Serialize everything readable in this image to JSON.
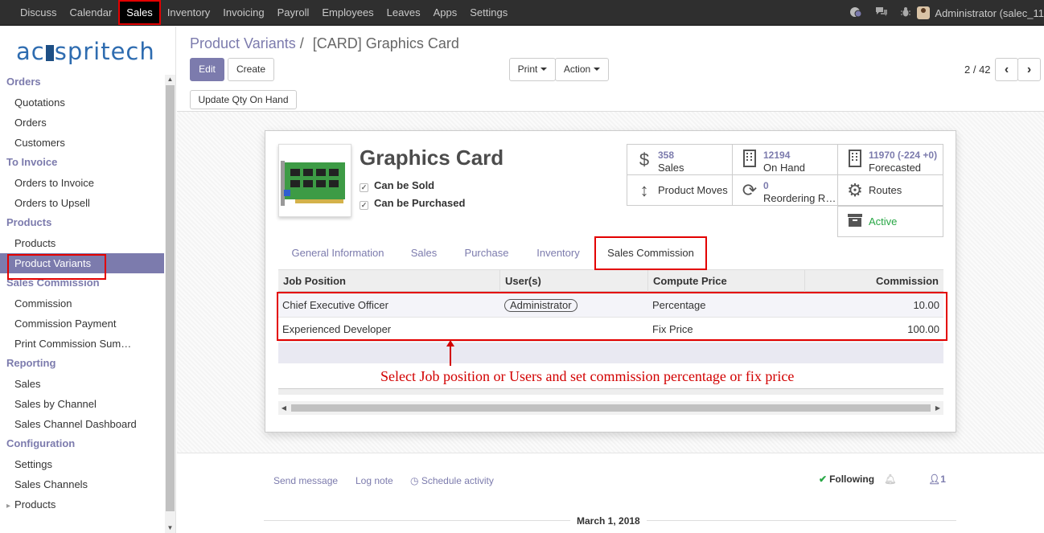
{
  "topbar": {
    "menu": [
      "Discuss",
      "Calendar",
      "Sales",
      "Inventory",
      "Invoicing",
      "Payroll",
      "Employees",
      "Leaves",
      "Apps",
      "Settings"
    ],
    "active": "Sales",
    "user": "Administrator (salec_11"
  },
  "sidebar": {
    "logo": {
      "left": "ac",
      "right": "spritech"
    },
    "sections": [
      {
        "heading": "Orders",
        "items": [
          "Quotations",
          "Orders",
          "Customers"
        ]
      },
      {
        "heading": "To Invoice",
        "items": [
          "Orders to Invoice",
          "Orders to Upsell"
        ]
      },
      {
        "heading": "Products",
        "items": [
          "Products",
          "Product Variants"
        ]
      },
      {
        "heading": "Sales Commission",
        "items": [
          "Commission",
          "Commission Payment",
          "Print Commission Sum…"
        ]
      },
      {
        "heading": "Reporting",
        "items": [
          "Sales",
          "Sales by Channel",
          "Sales Channel Dashboard"
        ]
      },
      {
        "heading": "Configuration",
        "items": [
          "Settings",
          "Sales Channels",
          "Products"
        ]
      }
    ],
    "selected": "Product Variants"
  },
  "breadcrumb": {
    "parent": "Product Variants",
    "sep": "/",
    "current": "[CARD] Graphics Card"
  },
  "buttons": {
    "edit": "Edit",
    "create": "Create",
    "print": "Print",
    "action": "Action",
    "update_qty": "Update Qty On Hand"
  },
  "pager": {
    "text": "2 / 42",
    "prev": "‹",
    "next": "›"
  },
  "product": {
    "name": "Graphics Card",
    "can_be_sold": "Can be Sold",
    "can_be_purchased": "Can be Purchased"
  },
  "smart_buttons": {
    "sales": {
      "value": "358",
      "label": "Sales"
    },
    "on_hand": {
      "value": "12194",
      "label": "On Hand"
    },
    "forecasted": {
      "value": "11970 (-224 +0)",
      "label": "Forecasted"
    },
    "moves": {
      "label": "Product Moves"
    },
    "reordering": {
      "value": "0",
      "label": "Reordering R…"
    },
    "routes": {
      "label": "Routes"
    },
    "active": {
      "label": "Active"
    }
  },
  "tabs": [
    "General Information",
    "Sales",
    "Purchase",
    "Inventory",
    "Sales Commission"
  ],
  "active_tab": "Sales Commission",
  "commission_table": {
    "columns": [
      "Job Position",
      "User(s)",
      "Compute Price",
      "Commission"
    ],
    "rows": [
      {
        "job": "Chief Executive Officer",
        "users": "Administrator",
        "compute": "Percentage",
        "commission": "10.00"
      },
      {
        "job": "Experienced Developer",
        "users": "",
        "compute": "Fix Price",
        "commission": "100.00"
      }
    ]
  },
  "annotation": "Select Job position or Users and set commission percentage or fix price",
  "chatter": {
    "send_message": "Send message",
    "log_note": "Log note",
    "schedule": "Schedule activity",
    "following": "Following",
    "followers": "1",
    "date": "March 1, 2018"
  }
}
